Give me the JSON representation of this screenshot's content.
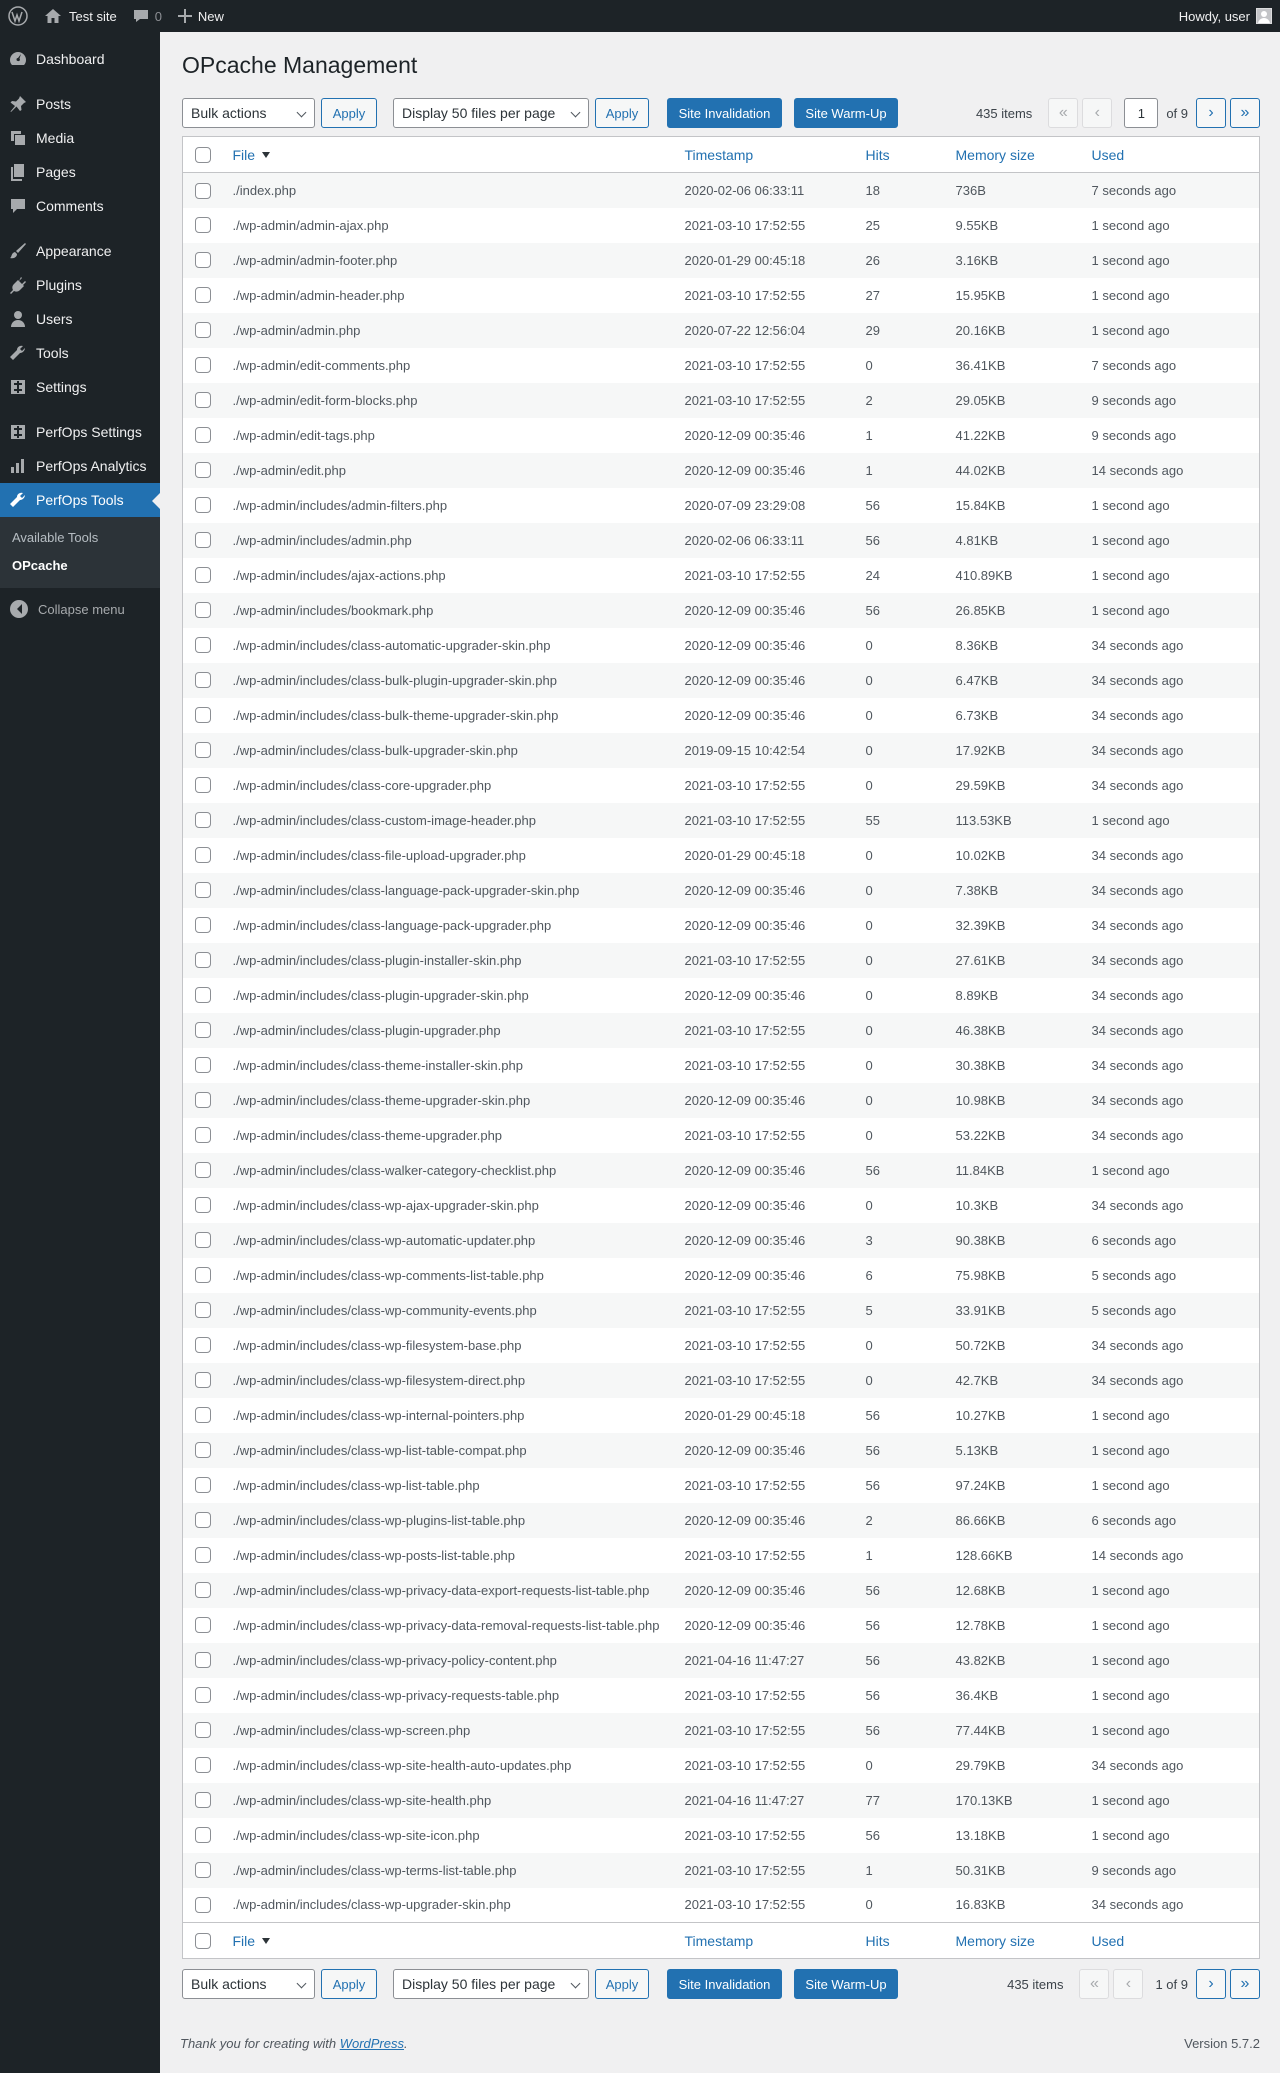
{
  "adminbar": {
    "site": "Test site",
    "comments": "0",
    "new": "New",
    "howdy": "Howdy, user"
  },
  "menu": {
    "dashboard": "Dashboard",
    "posts": "Posts",
    "media": "Media",
    "pages": "Pages",
    "comments": "Comments",
    "appearance": "Appearance",
    "plugins": "Plugins",
    "users": "Users",
    "tools": "Tools",
    "settings": "Settings",
    "perfops_settings": "PerfOps Settings",
    "perfops_analytics": "PerfOps Analytics",
    "perfops_tools": "PerfOps Tools",
    "sub_available": "Available Tools",
    "sub_opcache": "OPcache",
    "collapse": "Collapse menu"
  },
  "page": {
    "title": "OPcache Management"
  },
  "toolbar": {
    "bulk": "Bulk actions",
    "apply": "Apply",
    "display": "Display 50 files per page",
    "invalidate": "Site Invalidation",
    "warmup": "Site Warm-Up",
    "items": "435 items",
    "current_page": "1",
    "of": "of 9",
    "paging_text": "1 of 9"
  },
  "columns": {
    "file": "File",
    "timestamp": "Timestamp",
    "hits": "Hits",
    "memory": "Memory size",
    "used": "Used"
  },
  "rows": [
    [
      "./index.php",
      "2020-02-06 06:33:11",
      "18",
      "736B",
      "7 seconds ago"
    ],
    [
      "./wp-admin/admin-ajax.php",
      "2021-03-10 17:52:55",
      "25",
      "9.55KB",
      "1 second ago"
    ],
    [
      "./wp-admin/admin-footer.php",
      "2020-01-29 00:45:18",
      "26",
      "3.16KB",
      "1 second ago"
    ],
    [
      "./wp-admin/admin-header.php",
      "2021-03-10 17:52:55",
      "27",
      "15.95KB",
      "1 second ago"
    ],
    [
      "./wp-admin/admin.php",
      "2020-07-22 12:56:04",
      "29",
      "20.16KB",
      "1 second ago"
    ],
    [
      "./wp-admin/edit-comments.php",
      "2021-03-10 17:52:55",
      "0",
      "36.41KB",
      "7 seconds ago"
    ],
    [
      "./wp-admin/edit-form-blocks.php",
      "2021-03-10 17:52:55",
      "2",
      "29.05KB",
      "9 seconds ago"
    ],
    [
      "./wp-admin/edit-tags.php",
      "2020-12-09 00:35:46",
      "1",
      "41.22KB",
      "9 seconds ago"
    ],
    [
      "./wp-admin/edit.php",
      "2020-12-09 00:35:46",
      "1",
      "44.02KB",
      "14 seconds ago"
    ],
    [
      "./wp-admin/includes/admin-filters.php",
      "2020-07-09 23:29:08",
      "56",
      "15.84KB",
      "1 second ago"
    ],
    [
      "./wp-admin/includes/admin.php",
      "2020-02-06 06:33:11",
      "56",
      "4.81KB",
      "1 second ago"
    ],
    [
      "./wp-admin/includes/ajax-actions.php",
      "2021-03-10 17:52:55",
      "24",
      "410.89KB",
      "1 second ago"
    ],
    [
      "./wp-admin/includes/bookmark.php",
      "2020-12-09 00:35:46",
      "56",
      "26.85KB",
      "1 second ago"
    ],
    [
      "./wp-admin/includes/class-automatic-upgrader-skin.php",
      "2020-12-09 00:35:46",
      "0",
      "8.36KB",
      "34 seconds ago"
    ],
    [
      "./wp-admin/includes/class-bulk-plugin-upgrader-skin.php",
      "2020-12-09 00:35:46",
      "0",
      "6.47KB",
      "34 seconds ago"
    ],
    [
      "./wp-admin/includes/class-bulk-theme-upgrader-skin.php",
      "2020-12-09 00:35:46",
      "0",
      "6.73KB",
      "34 seconds ago"
    ],
    [
      "./wp-admin/includes/class-bulk-upgrader-skin.php",
      "2019-09-15 10:42:54",
      "0",
      "17.92KB",
      "34 seconds ago"
    ],
    [
      "./wp-admin/includes/class-core-upgrader.php",
      "2021-03-10 17:52:55",
      "0",
      "29.59KB",
      "34 seconds ago"
    ],
    [
      "./wp-admin/includes/class-custom-image-header.php",
      "2021-03-10 17:52:55",
      "55",
      "113.53KB",
      "1 second ago"
    ],
    [
      "./wp-admin/includes/class-file-upload-upgrader.php",
      "2020-01-29 00:45:18",
      "0",
      "10.02KB",
      "34 seconds ago"
    ],
    [
      "./wp-admin/includes/class-language-pack-upgrader-skin.php",
      "2020-12-09 00:35:46",
      "0",
      "7.38KB",
      "34 seconds ago"
    ],
    [
      "./wp-admin/includes/class-language-pack-upgrader.php",
      "2020-12-09 00:35:46",
      "0",
      "32.39KB",
      "34 seconds ago"
    ],
    [
      "./wp-admin/includes/class-plugin-installer-skin.php",
      "2021-03-10 17:52:55",
      "0",
      "27.61KB",
      "34 seconds ago"
    ],
    [
      "./wp-admin/includes/class-plugin-upgrader-skin.php",
      "2020-12-09 00:35:46",
      "0",
      "8.89KB",
      "34 seconds ago"
    ],
    [
      "./wp-admin/includes/class-plugin-upgrader.php",
      "2021-03-10 17:52:55",
      "0",
      "46.38KB",
      "34 seconds ago"
    ],
    [
      "./wp-admin/includes/class-theme-installer-skin.php",
      "2021-03-10 17:52:55",
      "0",
      "30.38KB",
      "34 seconds ago"
    ],
    [
      "./wp-admin/includes/class-theme-upgrader-skin.php",
      "2020-12-09 00:35:46",
      "0",
      "10.98KB",
      "34 seconds ago"
    ],
    [
      "./wp-admin/includes/class-theme-upgrader.php",
      "2021-03-10 17:52:55",
      "0",
      "53.22KB",
      "34 seconds ago"
    ],
    [
      "./wp-admin/includes/class-walker-category-checklist.php",
      "2020-12-09 00:35:46",
      "56",
      "11.84KB",
      "1 second ago"
    ],
    [
      "./wp-admin/includes/class-wp-ajax-upgrader-skin.php",
      "2020-12-09 00:35:46",
      "0",
      "10.3KB",
      "34 seconds ago"
    ],
    [
      "./wp-admin/includes/class-wp-automatic-updater.php",
      "2020-12-09 00:35:46",
      "3",
      "90.38KB",
      "6 seconds ago"
    ],
    [
      "./wp-admin/includes/class-wp-comments-list-table.php",
      "2020-12-09 00:35:46",
      "6",
      "75.98KB",
      "5 seconds ago"
    ],
    [
      "./wp-admin/includes/class-wp-community-events.php",
      "2021-03-10 17:52:55",
      "5",
      "33.91KB",
      "5 seconds ago"
    ],
    [
      "./wp-admin/includes/class-wp-filesystem-base.php",
      "2021-03-10 17:52:55",
      "0",
      "50.72KB",
      "34 seconds ago"
    ],
    [
      "./wp-admin/includes/class-wp-filesystem-direct.php",
      "2021-03-10 17:52:55",
      "0",
      "42.7KB",
      "34 seconds ago"
    ],
    [
      "./wp-admin/includes/class-wp-internal-pointers.php",
      "2020-01-29 00:45:18",
      "56",
      "10.27KB",
      "1 second ago"
    ],
    [
      "./wp-admin/includes/class-wp-list-table-compat.php",
      "2020-12-09 00:35:46",
      "56",
      "5.13KB",
      "1 second ago"
    ],
    [
      "./wp-admin/includes/class-wp-list-table.php",
      "2021-03-10 17:52:55",
      "56",
      "97.24KB",
      "1 second ago"
    ],
    [
      "./wp-admin/includes/class-wp-plugins-list-table.php",
      "2020-12-09 00:35:46",
      "2",
      "86.66KB",
      "6 seconds ago"
    ],
    [
      "./wp-admin/includes/class-wp-posts-list-table.php",
      "2021-03-10 17:52:55",
      "1",
      "128.66KB",
      "14 seconds ago"
    ],
    [
      "./wp-admin/includes/class-wp-privacy-data-export-requests-list-table.php",
      "2020-12-09 00:35:46",
      "56",
      "12.68KB",
      "1 second ago"
    ],
    [
      "./wp-admin/includes/class-wp-privacy-data-removal-requests-list-table.php",
      "2020-12-09 00:35:46",
      "56",
      "12.78KB",
      "1 second ago"
    ],
    [
      "./wp-admin/includes/class-wp-privacy-policy-content.php",
      "2021-04-16 11:47:27",
      "56",
      "43.82KB",
      "1 second ago"
    ],
    [
      "./wp-admin/includes/class-wp-privacy-requests-table.php",
      "2021-03-10 17:52:55",
      "56",
      "36.4KB",
      "1 second ago"
    ],
    [
      "./wp-admin/includes/class-wp-screen.php",
      "2021-03-10 17:52:55",
      "56",
      "77.44KB",
      "1 second ago"
    ],
    [
      "./wp-admin/includes/class-wp-site-health-auto-updates.php",
      "2021-03-10 17:52:55",
      "0",
      "29.79KB",
      "34 seconds ago"
    ],
    [
      "./wp-admin/includes/class-wp-site-health.php",
      "2021-04-16 11:47:27",
      "77",
      "170.13KB",
      "1 second ago"
    ],
    [
      "./wp-admin/includes/class-wp-site-icon.php",
      "2021-03-10 17:52:55",
      "56",
      "13.18KB",
      "1 second ago"
    ],
    [
      "./wp-admin/includes/class-wp-terms-list-table.php",
      "2021-03-10 17:52:55",
      "1",
      "50.31KB",
      "9 seconds ago"
    ],
    [
      "./wp-admin/includes/class-wp-upgrader-skin.php",
      "2021-03-10 17:52:55",
      "0",
      "16.83KB",
      "34 seconds ago"
    ]
  ],
  "footer": {
    "thanks_prefix": "Thank you for creating with ",
    "thanks_link": "WordPress",
    "thanks_suffix": ".",
    "version": "Version 5.7.2"
  },
  "colors": {
    "adminbar": "#1d2327",
    "accent": "#2271b1",
    "background": "#f0f0f1"
  }
}
